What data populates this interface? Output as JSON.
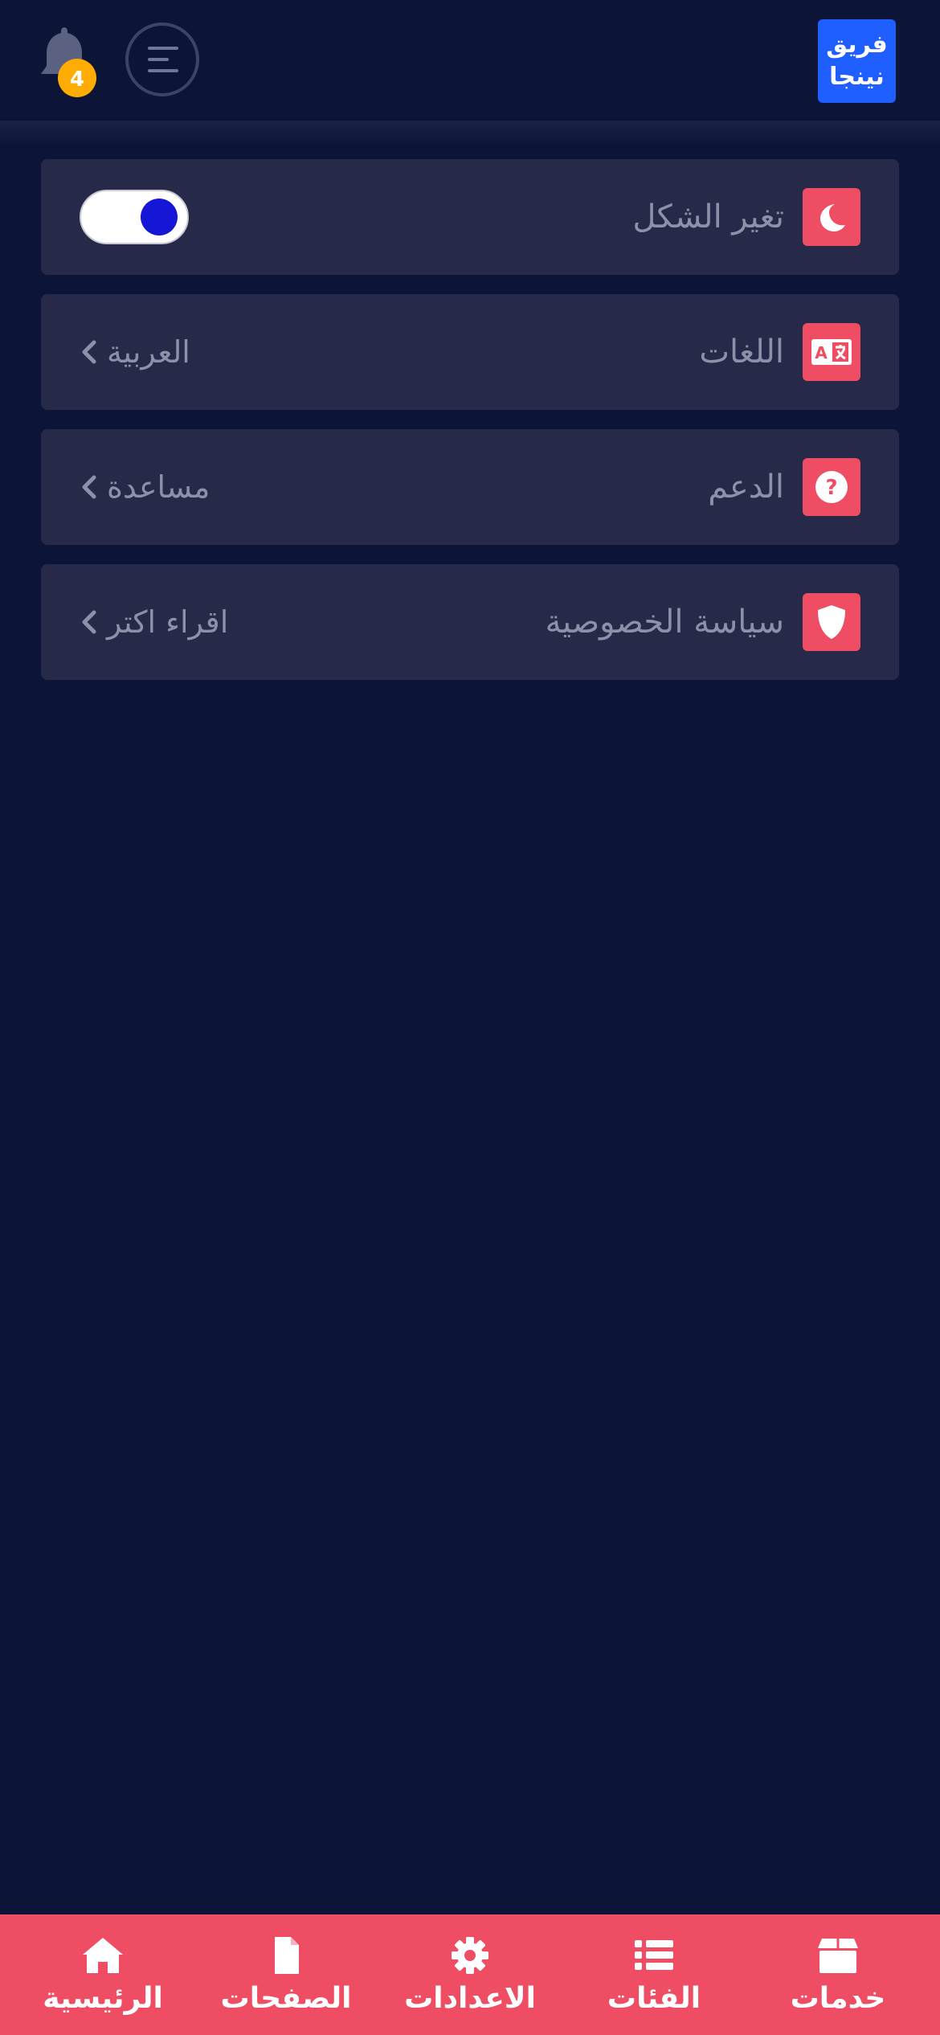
{
  "header": {
    "logo_line1": "فريق",
    "logo_line2": "نينجا",
    "notification_count": "4",
    "icons": {
      "notifications": "bell-icon",
      "menu": "menu-icon"
    }
  },
  "settings": {
    "items": [
      {
        "label": "تغير الشكل",
        "icon": "moon-icon",
        "control": "toggle",
        "toggle_on": true
      },
      {
        "label": "اللغات",
        "icon": "language-icon",
        "value": "العربية",
        "chevron": "chevron-left-icon"
      },
      {
        "label": "الدعم",
        "icon": "question-icon",
        "value": "مساعدة",
        "chevron": "chevron-left-icon"
      },
      {
        "label": "سياسة الخصوصية",
        "icon": "shield-icon",
        "value": "اقراء اكتر",
        "chevron": "chevron-left-icon"
      }
    ]
  },
  "bottom_nav": {
    "items": [
      {
        "label": "خدمات",
        "icon": "box-icon"
      },
      {
        "label": "الفئات",
        "icon": "list-icon"
      },
      {
        "label": "الاعدادات",
        "icon": "gear-icon"
      },
      {
        "label": "الصفحات",
        "icon": "file-icon"
      },
      {
        "label": "الرئيسية",
        "icon": "home-icon"
      }
    ]
  },
  "colors": {
    "background": "#0c1538",
    "card": "#262a48",
    "accent": "#ee4d63",
    "logo": "#1f5eff",
    "badge": "#ffab00",
    "toggle_knob": "#1616d6",
    "muted_text": "#8b91a8"
  }
}
